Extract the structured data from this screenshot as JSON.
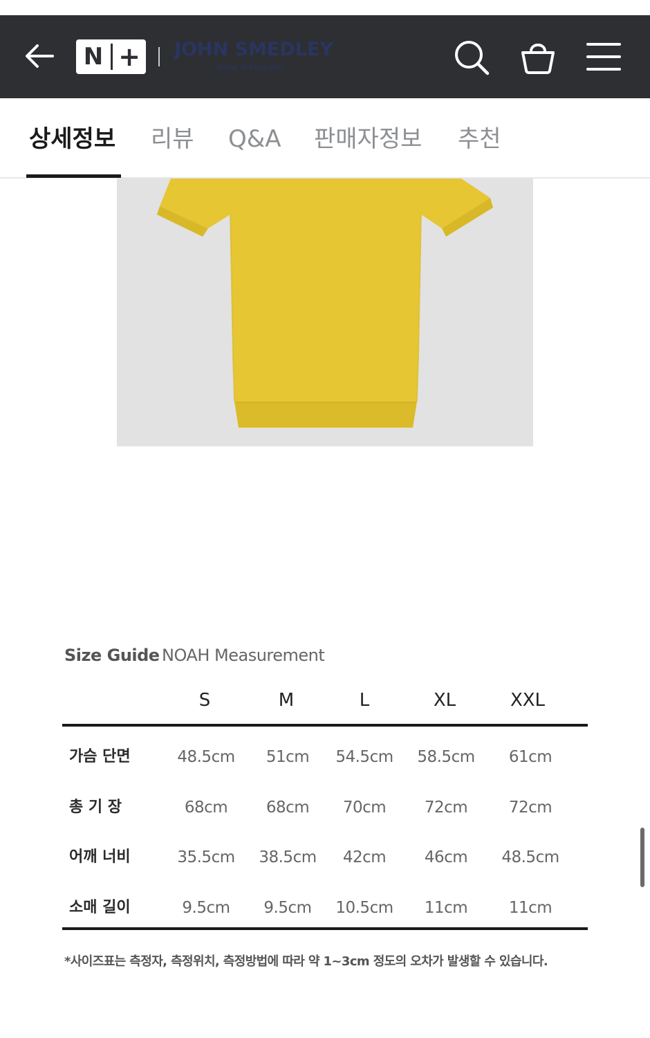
{
  "header": {
    "logo_n": "N",
    "logo_plus": "+",
    "brand_name": "JOHN SMEDLEY",
    "brand_sub": "MADE IN ENGLAND",
    "background_color": "#2d2f33",
    "icons": [
      "back-arrow-icon",
      "search-icon",
      "shopping-bag-icon",
      "hamburger-menu-icon"
    ]
  },
  "tabs": [
    {
      "label": "상세정보",
      "active": true
    },
    {
      "label": "리뷰",
      "active": false
    },
    {
      "label": "Q&A",
      "active": false
    },
    {
      "label": "판매자정보",
      "active": false
    },
    {
      "label": "추천",
      "active": false
    }
  ],
  "product": {
    "image_description": "yellow-knit-polo",
    "color": "#e6c632"
  },
  "size_guide": {
    "title": "Size Guide",
    "subtitle": "NOAH Measurement",
    "columns": [
      "S",
      "M",
      "L",
      "XL",
      "XXL"
    ],
    "rows": [
      {
        "label": "가슴 단면",
        "values": [
          "48.5cm",
          "51cm",
          "54.5cm",
          "58.5cm",
          "61cm"
        ]
      },
      {
        "label": "총 기 장",
        "values": [
          "68cm",
          "68cm",
          "70cm",
          "72cm",
          "72cm"
        ]
      },
      {
        "label": "어깨 너비",
        "values": [
          "35.5cm",
          "38.5cm",
          "42cm",
          "46cm",
          "48.5cm"
        ]
      },
      {
        "label": "소매 길이",
        "values": [
          "9.5cm",
          "9.5cm",
          "10.5cm",
          "11cm",
          "11cm"
        ]
      }
    ],
    "note": "*사이즈표는 측정자, 측정위치, 측정방법에 따라 약 1~3cm 정도의 오차가 발생할 수 있습니다."
  }
}
